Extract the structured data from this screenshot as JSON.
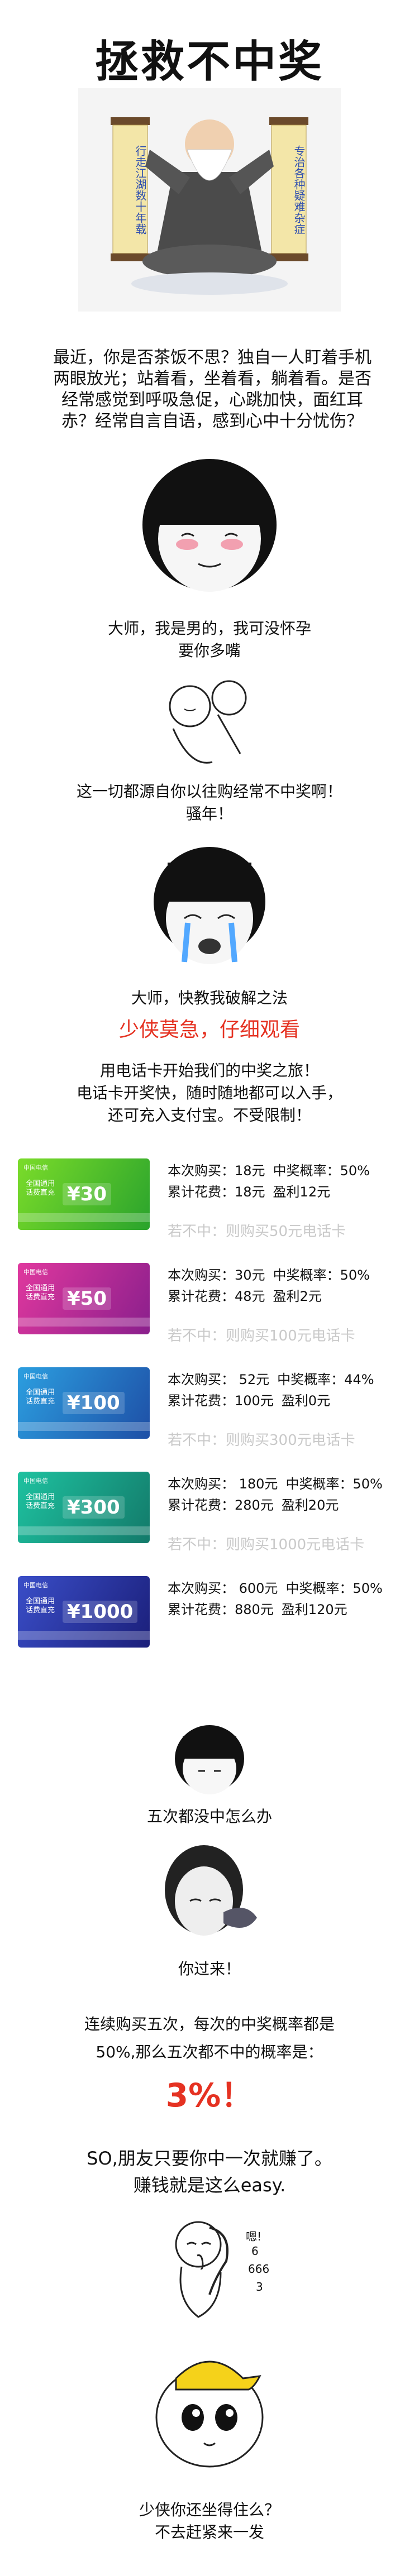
{
  "title": "拯救不中奖",
  "hero": {
    "left_scroll": "行走江湖数十年载",
    "right_scroll": "专治各种疑难杂症"
  },
  "intro": "最近，你是否茶饭不思？独自一人盯着手机两眼放光；站着看，坐着看，躺着看。是否经常感觉到呼吸急促，心跳加快，面红耳赤？经常自言自语，感到心中十分忧伤？",
  "caption1": [
    "大师，我是男的，我可没怀孕",
    "要你多嘴"
  ],
  "caption2": [
    "这一切都源自你以往购经常不中奖啊！",
    "骚年！"
  ],
  "caption3": "大师，快教我破解之法",
  "red_line": "少侠莫急，仔细观看",
  "caption4": [
    "用电话卡开始我们的中奖之旅！",
    "电话卡开奖快，随时随地都可以入手，",
    "还可充入支付宝。不受限制！"
  ],
  "cards": [
    {
      "amount": "¥30",
      "brand": "中国电信",
      "sub": "全国通用话费直充",
      "buy": "本次购买：18元",
      "rate": "中奖概率：50%",
      "total": "累计花费：18元",
      "profit": "盈利12元",
      "miss": "若不中：则购买50元电话卡",
      "c1": "#7bdc2a",
      "c2": "#2aa32c"
    },
    {
      "amount": "¥50",
      "brand": "中国电信",
      "sub": "全国通用话费直充",
      "buy": "本次购买：30元",
      "rate": "中奖概率：50%",
      "total": "累计花费：48元",
      "profit": "盈利2元",
      "miss": "若不中：则购买100元电话卡",
      "c1": "#e0389e",
      "c2": "#8a1f8c"
    },
    {
      "amount": "¥100",
      "brand": "中国电信",
      "sub": "全国通用话费直充",
      "buy": "本次购买： 52元",
      "rate": "中奖概率：44%",
      "total": "累计花费：100元",
      "profit": "盈利0元",
      "miss": "若不中：则购买300元电话卡",
      "c1": "#2c9fe0",
      "c2": "#1e4fa6"
    },
    {
      "amount": "¥300",
      "brand": "中国电信",
      "sub": "全国通用话费直充",
      "buy": "本次购买： 180元",
      "rate": "中奖概率：50%",
      "total": "累计花费：280元",
      "profit": "盈利20元",
      "miss": "若不中：则购买1000元电话卡",
      "c1": "#1ec2a0",
      "c2": "#137a6a"
    },
    {
      "amount": "¥1000",
      "brand": "中国电信",
      "sub": "全国通用话费直充",
      "buy": "本次购买： 600元",
      "rate": "中奖概率：50%",
      "total": "累计花费：880元",
      "profit": "盈利120元",
      "miss": "",
      "c1": "#3a4ec8",
      "c2": "#1b1f7a"
    }
  ],
  "caption5": "五次都没中怎么办",
  "caption6": "你过来！",
  "caption7": [
    "连续购买五次，每次的中奖概率都是",
    "50%,那么五次都不中的概率是："
  ],
  "big_percent": "3%！",
  "caption8": [
    "SO,朋友只要你中一次就赚了。",
    "赚钱就是这么easy."
  ],
  "meme_text": [
    "嗯!",
    "6",
    "666",
    "3"
  ],
  "caption9": [
    "少侠你还坐得住么？",
    "不去赶紧来一发"
  ]
}
